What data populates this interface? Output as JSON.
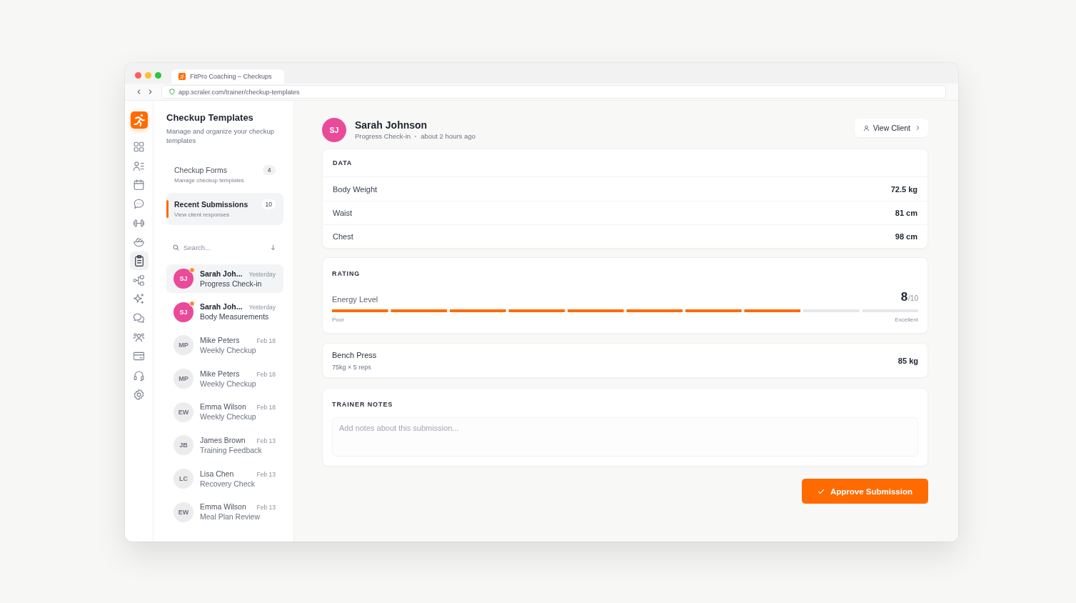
{
  "browser": {
    "tab_title": "FitPro Coaching – Checkups",
    "url": "app.scraler.com/trainer/checkup-templates"
  },
  "icon_rail": [
    {
      "selected": false
    },
    {
      "selected": false
    },
    {
      "selected": false
    },
    {
      "selected": false
    },
    {
      "selected": false
    },
    {
      "selected": false
    },
    {
      "selected": true
    },
    {
      "selected": false
    },
    {
      "selected": false
    },
    {
      "selected": false
    },
    {
      "selected": false
    },
    {
      "selected": false
    },
    {
      "selected": false
    },
    {
      "selected": false
    }
  ],
  "panel": {
    "title": "Checkup Templates",
    "subtitle": "Manage and organize your checkup templates",
    "sections": [
      {
        "label": "Checkup Forms",
        "count": "4",
        "description": "Manage checkup templates",
        "selected": false
      },
      {
        "label": "Recent Submissions",
        "count": "10",
        "description": "View client responses",
        "selected": true
      }
    ],
    "search": {
      "placeholder": "Search..."
    },
    "submissions": [
      {
        "initials": "SJ",
        "name": "Sarah Joh...",
        "date": "Yesterday",
        "form": "Progress Check-in",
        "unread": true,
        "selected": true
      },
      {
        "initials": "SJ",
        "name": "Sarah Joh...",
        "date": "Yesterday",
        "form": "Body Measurements",
        "unread": true,
        "selected": false
      },
      {
        "initials": "MP",
        "name": "Mike Peters",
        "date": "Feb 18",
        "form": "Weekly Checkup",
        "unread": false,
        "selected": false
      },
      {
        "initials": "MP",
        "name": "Mike Peters",
        "date": "Feb 18",
        "form": "Weekly Checkup",
        "unread": false,
        "selected": false
      },
      {
        "initials": "EW",
        "name": "Emma Wilson",
        "date": "Feb 18",
        "form": "Weekly Checkup",
        "unread": false,
        "selected": false
      },
      {
        "initials": "JB",
        "name": "James Brown",
        "date": "Feb 13",
        "form": "Training Feedback",
        "unread": false,
        "selected": false
      },
      {
        "initials": "LC",
        "name": "Lisa Chen",
        "date": "Feb 13",
        "form": "Recovery Check",
        "unread": false,
        "selected": false
      },
      {
        "initials": "EW",
        "name": "Emma Wilson",
        "date": "Feb 13",
        "form": "Meal Plan Review",
        "unread": false,
        "selected": false
      }
    ]
  },
  "submission": {
    "initials": "SJ",
    "client": "Sarah Johnson",
    "form": "Progress Check-in",
    "time": "about 2 hours ago",
    "view_button": "View Client",
    "data": {
      "heading": "DATA",
      "rows": [
        {
          "label": "Body Weight",
          "value": "72.5 kg"
        },
        {
          "label": "Waist",
          "value": "81 cm"
        },
        {
          "label": "Chest",
          "value": "98 cm"
        }
      ]
    },
    "rating": {
      "heading": "RATING",
      "label": "Energy Level",
      "score": "8",
      "scale": "/10",
      "level": 0.8,
      "low_label": "Poor",
      "high_label": "Excellent"
    },
    "exercise": {
      "name": "Bench Press",
      "detail": "75kg × 5 reps",
      "value": "85 kg"
    },
    "notes": {
      "heading": "TRAINER NOTES",
      "placeholder": "Add notes about this submission..."
    },
    "approve_button": "Approve Submission"
  }
}
